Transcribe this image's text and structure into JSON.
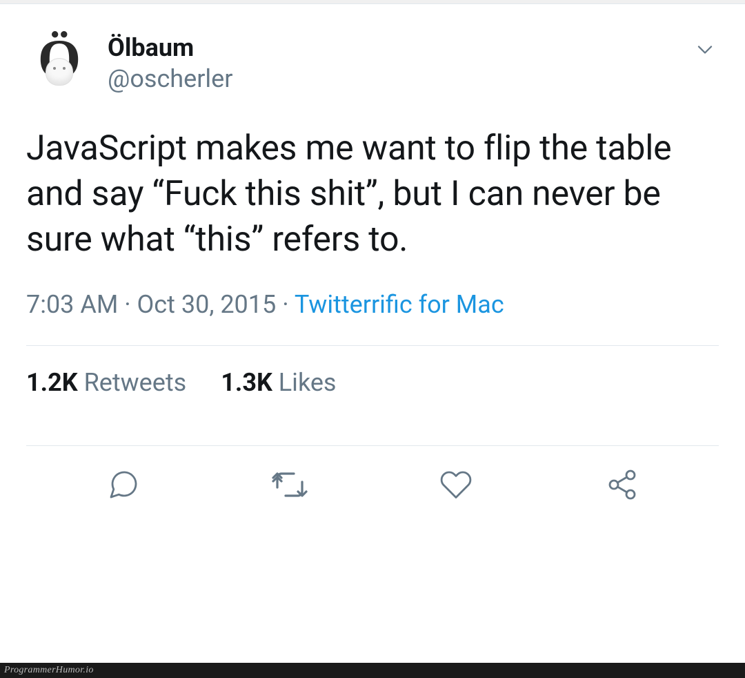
{
  "user": {
    "display_name": "Ölbaum",
    "handle": "@oscherler",
    "avatar_glyph": "Ö"
  },
  "tweet": {
    "text": "JavaScript makes me want to flip the table and say “Fuck this shit”, but I can never be sure what “this” refers to.",
    "time": "7:03 AM",
    "date": "Oct 30, 2015",
    "source": "Twitterrific for Mac",
    "separator": " · "
  },
  "stats": {
    "retweets_count": "1.2K",
    "retweets_label": "Retweets",
    "likes_count": "1.3K",
    "likes_label": "Likes"
  },
  "icons": {
    "reply": "reply-icon",
    "retweet": "retweet-icon",
    "like": "like-icon",
    "share": "share-icon",
    "caret": "chevron-down-icon"
  },
  "footer": {
    "watermark": "ProgrammerHumor.io"
  },
  "colors": {
    "text_primary": "#14171a",
    "text_secondary": "#657786",
    "link": "#1b95e0",
    "icon_stroke": "#657786",
    "border": "#e1e8ed"
  }
}
